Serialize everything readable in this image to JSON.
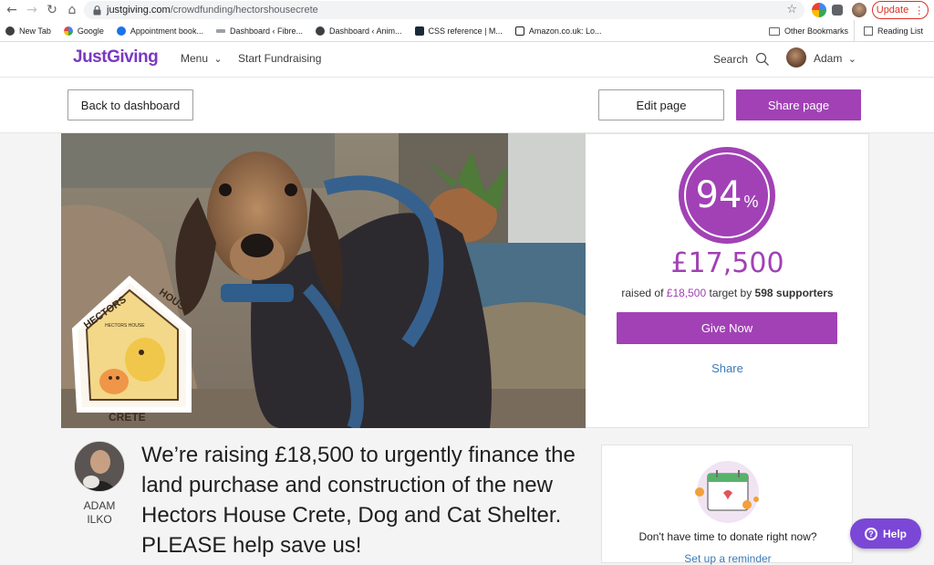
{
  "browser": {
    "url_host": "justgiving.com",
    "url_path": "/crowdfunding/hectorshousecrete",
    "update_label": "Update",
    "bookmarks": [
      "New Tab",
      "Google",
      "Appointment book...",
      "Dashboard ‹ Fibre...",
      "Dashboard ‹ Anim...",
      "CSS reference | M...",
      "Amazon.co.uk: Lo..."
    ],
    "other_bookmarks": "Other Bookmarks",
    "reading_list": "Reading List"
  },
  "header": {
    "logo": "JustGiving",
    "menu": "Menu",
    "start": "Start Fundraising",
    "search": "Search",
    "user": "Adam"
  },
  "actions": {
    "back": "Back to dashboard",
    "edit": "Edit page",
    "share": "Share page"
  },
  "photo": {
    "logo_top": "HECTORS",
    "logo_house": "HOUSE",
    "logo_small": "HECTORS HOUSE",
    "logo_bottom": "CRETE"
  },
  "donation": {
    "percent": "94",
    "percent_sign": "%",
    "raised": "£17,500",
    "raised_of": "raised of",
    "target": "£18,500",
    "target_by": "target by",
    "supporters": "598 supporters",
    "give_now": "Give Now",
    "share": "Share"
  },
  "author": {
    "name_first": "ADAM",
    "name_last": "ILKO"
  },
  "headline": "We’re raising £18,500 to urgently finance the land purchase and construction of the new Hectors House Crete, Dog and Cat Shelter. PLEASE help save us!",
  "reminder": {
    "text": "Don't have time to donate right now?",
    "link": "Set up a reminder"
  },
  "help": "Help",
  "colors": {
    "brand": "#7a38c2",
    "accent": "#a141b5",
    "link": "#3c7ab8"
  }
}
